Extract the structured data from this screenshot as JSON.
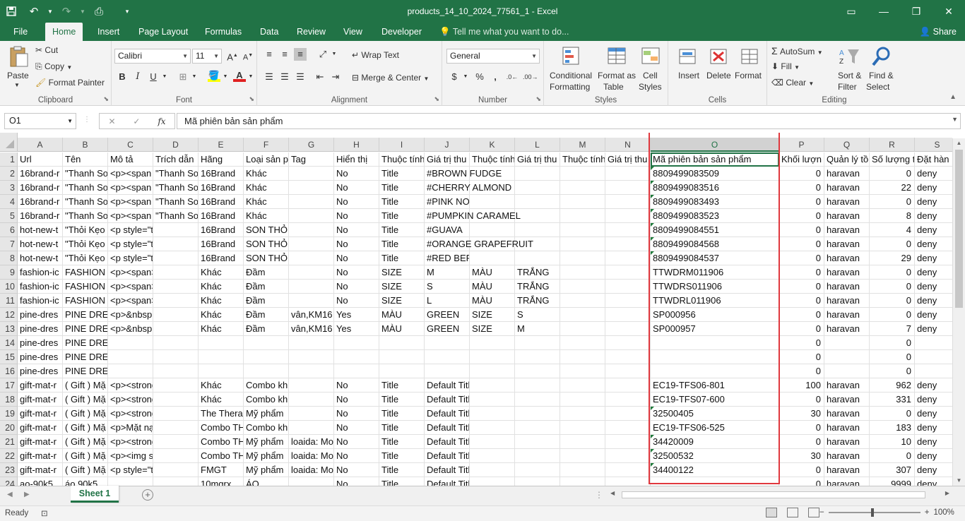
{
  "window": {
    "title": "products_14_10_2024_77561_1 - Excel",
    "share_label": "Share",
    "tell_me": "Tell me what you want to do..."
  },
  "tabs": [
    "File",
    "Home",
    "Insert",
    "Page Layout",
    "Formulas",
    "Data",
    "Review",
    "View",
    "Developer"
  ],
  "ribbon": {
    "clipboard": {
      "label": "Clipboard",
      "paste": "Paste",
      "cut": "Cut",
      "copy": "Copy",
      "format_painter": "Format Painter"
    },
    "font": {
      "label": "Font",
      "family": "Calibri",
      "size": "11"
    },
    "alignment": {
      "label": "Alignment",
      "wrap": "Wrap Text",
      "merge": "Merge & Center"
    },
    "number": {
      "label": "Number",
      "format": "General"
    },
    "styles": {
      "label": "Styles",
      "cond1": "Conditional",
      "cond2": "Formatting",
      "fmt1": "Format as",
      "fmt2": "Table",
      "cell1": "Cell",
      "cell2": "Styles"
    },
    "cells": {
      "label": "Cells",
      "insert": "Insert",
      "delete": "Delete",
      "format": "Format"
    },
    "editing": {
      "label": "Editing",
      "autosum": "AutoSum",
      "fill": "Fill",
      "clear": "Clear",
      "sort1": "Sort &",
      "sort2": "Filter",
      "find1": "Find &",
      "find2": "Select"
    }
  },
  "formula_bar": {
    "name_box": "O1",
    "formula": "Mã phiên bản sản phẩm"
  },
  "columns": [
    "A",
    "B",
    "C",
    "D",
    "E",
    "F",
    "G",
    "H",
    "I",
    "J",
    "K",
    "L",
    "M",
    "N",
    "O",
    "P",
    "Q",
    "R",
    "S"
  ],
  "rows": [
    [
      "Url",
      "Tên",
      "Mô tả",
      "Trích dẫn",
      "Hãng",
      "Loại sản p",
      "Tag",
      "Hiển thị",
      "Thuộc tính",
      "Giá trị thu",
      "Thuộc tính",
      "Giá trị thu",
      "Thuộc tính",
      "Giá trị thu",
      "Mã phiên bản sản phẩm",
      "Khối lượn",
      "Quản lý tồ",
      "Số lượng t",
      "Đặt hàn"
    ],
    [
      "16brand-r",
      "\"Thanh So",
      "<p><span",
      "\"Thanh So",
      "16Brand",
      "Khác",
      "",
      "No",
      "Title",
      "#BROWN FUDGE",
      "",
      "",
      "",
      "",
      "8809499083509",
      "0",
      "haravan",
      "0",
      "deny"
    ],
    [
      "16brand-r",
      "\"Thanh So",
      "<p><span",
      "\"Thanh So",
      "16Brand",
      "Khác",
      "",
      "No",
      "Title",
      "#CHERRY ALMOND",
      "",
      "",
      "",
      "",
      "8809499083516",
      "0",
      "haravan",
      "22",
      "deny"
    ],
    [
      "16brand-r",
      "\"Thanh So",
      "<p><span",
      "\"Thanh So",
      "16Brand",
      "Khác",
      "",
      "No",
      "Title",
      "#PINK NOUGAT",
      "",
      "",
      "",
      "",
      "8809499083493",
      "0",
      "haravan",
      "0",
      "deny"
    ],
    [
      "16brand-r",
      "\"Thanh So",
      "<p><span",
      "\"Thanh So",
      "16Brand",
      "Khác",
      "",
      "No",
      "Title",
      "#PUMPKIN CARAMEL",
      "",
      "",
      "",
      "",
      "8809499083523",
      "0",
      "haravan",
      "8",
      "deny"
    ],
    [
      "hot-new-t",
      "\"Thỏi Kẹo",
      "<p style=\"text-align:",
      "",
      "16Brand",
      "SON THỎI",
      "",
      "No",
      "Title",
      "#GUAVA",
      "",
      "",
      "",
      "",
      "8809499084551",
      "0",
      "haravan",
      "4",
      "deny"
    ],
    [
      "hot-new-t",
      "\"Thỏi Kẹo",
      "<p style=\"text-align:",
      "",
      "16Brand",
      "SON THỎI",
      "",
      "No",
      "Title",
      "#ORANGE GRAPEFRUIT",
      "",
      "",
      "",
      "",
      "8809499084568",
      "0",
      "haravan",
      "0",
      "deny"
    ],
    [
      "hot-new-t",
      "\"Thỏi Kẹo",
      "<p style=\"text-align:",
      "",
      "16Brand",
      "SON THỎI",
      "",
      "No",
      "Title",
      "#RED BERRY",
      "",
      "",
      "",
      "",
      "8809499084537",
      "0",
      "haravan",
      "29",
      "deny"
    ],
    [
      "fashion-ic",
      "FASHION I",
      "<p><span>Đầm tay n",
      "",
      "Khác",
      "Đầm",
      "",
      "No",
      "SIZE",
      "M",
      "MÀU",
      "TRẮNG",
      "",
      "",
      "TTWDRM011906",
      "0",
      "haravan",
      "0",
      "deny"
    ],
    [
      "fashion-ic",
      "FASHION I",
      "<p><span>Đầm tay n",
      "",
      "Khác",
      "Đầm",
      "",
      "No",
      "SIZE",
      "S",
      "MÀU",
      "TRẮNG",
      "",
      "",
      "TTWDRS011906",
      "0",
      "haravan",
      "0",
      "deny"
    ],
    [
      "fashion-ic",
      "FASHION I",
      "<p><span>Đầm tay n",
      "",
      "Khác",
      "Đầm",
      "",
      "No",
      "SIZE",
      "L",
      "MÀU",
      "TRẮNG",
      "",
      "",
      "TTWDRL011906",
      "0",
      "haravan",
      "0",
      "deny"
    ],
    [
      "pine-dres",
      "PINE DRES",
      "<p>&nbsp;</p><p><s",
      "",
      "Khác",
      "Đầm",
      "vân,KM16",
      "Yes",
      "MÀU",
      "GREEN",
      "SIZE",
      "S",
      "",
      "",
      "SP000956",
      "0",
      "haravan",
      "0",
      "deny"
    ],
    [
      "pine-dres",
      "PINE DRES",
      "<p>&nbsp;</p><p><s",
      "",
      "Khác",
      "Đầm",
      "vân,KM16",
      "Yes",
      "MÀU",
      "GREEN",
      "SIZE",
      "M",
      "",
      "",
      "SP000957",
      "0",
      "haravan",
      "7",
      "deny"
    ],
    [
      "pine-dres",
      "PINE DRESS",
      "",
      "",
      "",
      "",
      "",
      "",
      "",
      "",
      "",
      "",
      "",
      "",
      "",
      "0",
      "",
      "0",
      ""
    ],
    [
      "pine-dres",
      "PINE DRESS",
      "",
      "",
      "",
      "",
      "",
      "",
      "",
      "",
      "",
      "",
      "",
      "",
      "",
      "0",
      "",
      "0",
      ""
    ],
    [
      "pine-dres",
      "PINE DRESS",
      "",
      "",
      "",
      "",
      "",
      "",
      "",
      "",
      "",
      "",
      "",
      "",
      "",
      "0",
      "",
      "0",
      ""
    ],
    [
      "gift-mat-r",
      "( Gift ) Mặ",
      "<p><strong>Công dụ",
      "",
      "Khác",
      "Combo kh",
      "",
      "No",
      "Title",
      "Default Title",
      "",
      "",
      "",
      "",
      "EC19-TFS06-801",
      "100",
      "haravan",
      "962",
      "deny"
    ],
    [
      "gift-mat-r",
      "( Gift ) Mặ",
      "<p><strong>Công dụ",
      "",
      "Khác",
      "Combo kh",
      "",
      "No",
      "Title",
      "Default Title",
      "",
      "",
      "",
      "",
      "EC19-TFS07-600",
      "0",
      "haravan",
      "331",
      "deny"
    ],
    [
      "gift-mat-r",
      "( Gift ) Mặ",
      "<p><strong>Công dụ",
      "",
      "The Thera",
      "Mỹ phẩm",
      "",
      "No",
      "Title",
      "Default Title",
      "",
      "",
      "",
      "",
      "32500405",
      "30",
      "haravan",
      "0",
      "deny"
    ],
    [
      "gift-mat-r",
      "( Gift ) Mặ",
      "<p>Mặt nạ chứa Mac",
      "",
      "Combo TH",
      "Combo kh",
      "",
      "No",
      "Title",
      "Default Title",
      "",
      "",
      "",
      "",
      "EC19-TFS06-525",
      "0",
      "haravan",
      "183",
      "deny"
    ],
    [
      "gift-mat-r",
      "( Gift ) Mặ",
      "<p><strong>Công dụ",
      "",
      "Combo TH",
      "Mỹ phẩm",
      "loaida: Mo",
      "No",
      "Title",
      "Default Title",
      "",
      "",
      "",
      "",
      "34420009",
      "0",
      "haravan",
      "10",
      "deny"
    ],
    [
      "gift-mat-r",
      "( Gift ) Mặ",
      "<p><img src=\"//file.h",
      "",
      "Combo TH",
      "Mỹ phẩm",
      "loaida: Mo",
      "No",
      "Title",
      "Default Title",
      "",
      "",
      "",
      "",
      "32500532",
      "30",
      "haravan",
      "0",
      "deny"
    ],
    [
      "gift-mat-r",
      "( Gift ) Mặ",
      "<p style=\"text-align:",
      "",
      "FMGT",
      "Mỹ phẩm",
      "loaida: Mo",
      "No",
      "Title",
      "Default Title",
      "",
      "",
      "",
      "",
      "34400122",
      "0",
      "haravan",
      "307",
      "deny"
    ],
    [
      "ao-90k5",
      "áo 90k5",
      "",
      "",
      "10mgrx",
      "ÁO",
      "",
      "No",
      "Title",
      "Default Title",
      "",
      "",
      "",
      "",
      "",
      "0",
      "haravan",
      "9999",
      "deny"
    ]
  ],
  "sheet": {
    "name": "Sheet 1"
  },
  "status": {
    "ready": "Ready",
    "zoom": "100%"
  }
}
